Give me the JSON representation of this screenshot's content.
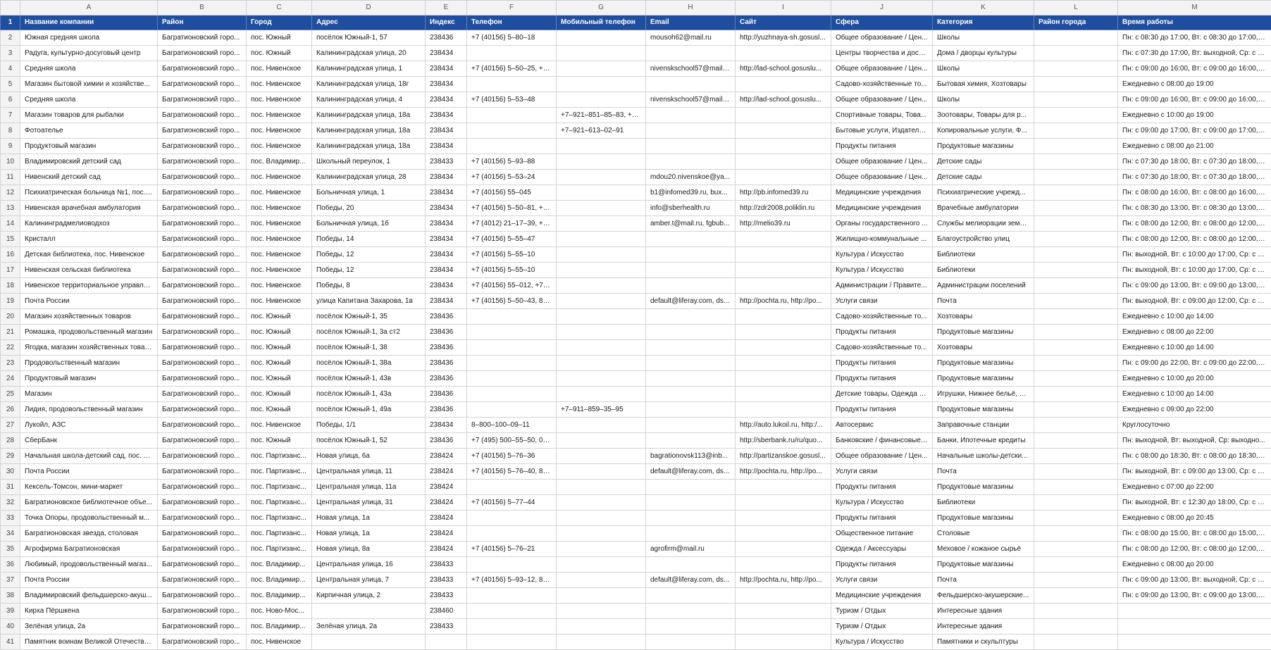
{
  "colors": {
    "header_bg": "#1f4e9e",
    "header_text": "#ffffff",
    "grid": "#d4d4d4"
  },
  "column_letters": [
    "A",
    "B",
    "C",
    "D",
    "E",
    "F",
    "G",
    "H",
    "I",
    "J",
    "K",
    "L",
    "M"
  ],
  "headers": [
    "Название компании",
    "Район",
    "Город",
    "Адрес",
    "Индекс",
    "Телефон",
    "Мобильный телефон",
    "Email",
    "Сайт",
    "Сфера",
    "Категория",
    "Район города",
    "Время работы"
  ],
  "rows": [
    {
      "n": "2",
      "c": [
        "Южная средняя школа",
        "Багратионовский горо...",
        "пос. Южный",
        "посёлок Южный-1, 57",
        "238436",
        "+7 (40156) 5‒80‒18",
        "",
        "mousoh62@mail.ru",
        "http://yuzhnaya-sh.gosusl...",
        "Общее образование / Цен...",
        "Школы",
        "",
        "Пн: с 08:30 до 17:00, Вт: с 08:30 до 17:00, Ср..."
      ]
    },
    {
      "n": "3",
      "c": [
        "Радуга, культурно-досуговый центр",
        "Багратионовский горо...",
        "пос. Южный",
        "Калининградская улица, 20",
        "238434",
        "",
        "",
        "",
        "",
        "Центры творчества и досуга",
        "Дома / дворцы культуры",
        "",
        "Пн: с 07:30 до 17:00, Вт: выходной, Ср: с 0..."
      ]
    },
    {
      "n": "4",
      "c": [
        "Средняя школа",
        "Багратионовский горо...",
        "пос. Нивенское",
        "Калининградская улица, 1",
        "238434",
        "+7 (40156) 5‒50‒25, +7...",
        "",
        "nivenskschool57@mail.r...",
        "http://lad-school.gosuslu...",
        "Общее образование / Цен...",
        "Школы",
        "",
        "Пн: с 09:00 до 16:00, Вт: с 09:00 до 16:00, С..."
      ]
    },
    {
      "n": "5",
      "c": [
        "Магазин бытовой химии и хозяйстве...",
        "Багратионовский горо...",
        "пос. Нивенское",
        "Калининградская улица, 18г",
        "238434",
        "",
        "",
        "",
        "",
        "Садово-хозяйственные то...",
        "Бытовая химия, Хозтовары",
        "",
        "Ежедневно с 08:00 до 19:00"
      ]
    },
    {
      "n": "6",
      "c": [
        "Средняя школа",
        "Багратионовский горо...",
        "пос. Нивенское",
        "Калининградская улица, 4",
        "238434",
        "+7 (40156) 5‒53‒48",
        "",
        "nivenskschool57@mail.r...",
        "http://lad-school.gosuslu...",
        "Общее образование / Цен...",
        "Школы",
        "",
        "Пн: с 09:00 до 16:00, Вт: с 09:00 до 16:00, С..."
      ]
    },
    {
      "n": "7",
      "c": [
        "Магазин товаров для рыбалки",
        "Багратионовский горо...",
        "пос. Нивенское",
        "Калининградская улица, 18а",
        "238434",
        "",
        "+7‒921‒851‒85‒83, +7...",
        "",
        "",
        "Спортивные товары, Това...",
        "Зоотовары, Товары для р...",
        "",
        "Ежедневно с 10:00 до 19:00"
      ]
    },
    {
      "n": "8",
      "c": [
        "Фотоателье",
        "Багратионовский горо...",
        "пос. Нивенское",
        "Калининградская улица, 18а",
        "238434",
        "",
        "+7‒921‒613‒02‒91",
        "",
        "",
        "Бытовые услуги, Издатель...",
        "Копировальные услуги, Ф...",
        "",
        "Пн: с 09:00 до 17:00, Вт: с 09:00 до 17:00, С..."
      ]
    },
    {
      "n": "9",
      "c": [
        "Продуктовый магазин",
        "Багратионовский горо...",
        "пос. Нивенское",
        "Калининградская улица, 18а",
        "238434",
        "",
        "",
        "",
        "",
        "Продукты питания",
        "Продуктовые магазины",
        "",
        "Ежедневно с 08:00 до 21:00"
      ]
    },
    {
      "n": "10",
      "c": [
        "Владимировский детский сад",
        "Багратионовский горо...",
        "пос. Владимир...",
        "Школьный переулок, 1",
        "238433",
        "+7 (40156) 5‒93‒88",
        "",
        "",
        "",
        "Общее образование / Цен...",
        "Детские сады",
        "",
        "Пн: с 07:30 до 18:00, Вт: с 07:30 до 18:00, С..."
      ]
    },
    {
      "n": "11",
      "c": [
        "Нивенский детский сад",
        "Багратионовский горо...",
        "пос. Нивенское",
        "Калининградская улица, 28",
        "238434",
        "+7 (40156) 5‒53‒24",
        "",
        "mdou20.nivenskoe@ya...",
        "",
        "Общее образование / Цен...",
        "Детские сады",
        "",
        "Пн: с 07:30 до 18:00, Вт: с 07:30 до 18:00, С..."
      ]
    },
    {
      "n": "12",
      "c": [
        "Психиатрическая больница №1, пос. ...",
        "Багратионовский горо...",
        "пос. Нивенское",
        "Больничная улица, 1",
        "238434",
        "+7 (40156) 55‒045",
        "",
        "b1@infomed39.ru, bux...",
        "http://pb.infomed39.ru",
        "Медицинские учреждения",
        "Психиатрические учрежд...",
        "",
        "Пн: с 08:00 до 16:00, Вт: с 08:00 до 16:00, С..."
      ]
    },
    {
      "n": "13",
      "c": [
        "Нивенская врачебная амбулатория",
        "Багратионовский горо...",
        "пос. Нивенское",
        "Победы, 20",
        "238434",
        "+7 (40156) 5‒50‒81, +7...",
        "",
        "info@sberhealth.ru",
        "http://zdr2008.poliklin.ru",
        "Медицинские учреждения",
        "Врачебные амбулатории",
        "",
        "Пн: с 08:30 до 13:00, Вт: с 08:30 до 13:00, С..."
      ]
    },
    {
      "n": "14",
      "c": [
        "Калининградмелиоводхоз",
        "Багратионовский горо...",
        "пос. Нивенское",
        "Больничная улица, 1б",
        "238434",
        "+7 (4012) 21‒17‒39, +7...",
        "",
        "amber.t@mail.ru, fgbub...",
        "http://melio39.ru",
        "Органы государственного ...",
        "Службы мелиорации земе...",
        "",
        "Пн: с 08:00 до 12:00, Вт: с 08:00 до 12:00, С..."
      ]
    },
    {
      "n": "15",
      "c": [
        "Кристалл",
        "Багратионовский горо...",
        "пос. Нивенское",
        "Победы, 14",
        "238434",
        "+7 (40156) 5‒55‒47",
        "",
        "",
        "",
        "Жилищно-коммунальные ...",
        "Благоустройство улиц",
        "",
        "Пн: с 08:00 до 12:00, Вт: с 08:00 до 12:00, С..."
      ]
    },
    {
      "n": "16",
      "c": [
        "Детская библиотека, пос. Нивенское",
        "Багратионовский горо...",
        "пос. Нивенское",
        "Победы, 12",
        "238434",
        "+7 (40156) 5‒55‒10",
        "",
        "",
        "",
        "Культура / Искусство",
        "Библиотеки",
        "",
        "Пн: выходной, Вт: с 10:00 до 17:00, Ср: с 1..."
      ]
    },
    {
      "n": "17",
      "c": [
        "Нивенская сельская библиотека",
        "Багратионовский горо...",
        "пос. Нивенское",
        "Победы, 12",
        "238434",
        "+7 (40156) 5‒55‒10",
        "",
        "",
        "",
        "Культура / Искусство",
        "Библиотеки",
        "",
        "Пн: выходной, Вт: с 10:00 до 17:00, Ср: с 1..."
      ]
    },
    {
      "n": "18",
      "c": [
        "Нивенское территориальное управле...",
        "Багратионовский горо...",
        "пос. Нивенское",
        "Победы, 8",
        "238434",
        "+7 (40156) 55‒012, +7 (...",
        "",
        "",
        "",
        "Администрации / Правите...",
        "Администрации поселений",
        "",
        "Пн: с 09:00 до 13:00, Вт: с 09:00 до 13:00, С..."
      ]
    },
    {
      "n": "19",
      "c": [
        "Почта России",
        "Багратионовский горо...",
        "пос. Нивенское",
        "улица Капитана Захарова, 1в",
        "238434",
        "+7 (40156) 5‒50‒43, 8‒...",
        "",
        "default@liferay.com, ds...",
        "http://pochta.ru, http://po...",
        "Услуги связи",
        "Почта",
        "",
        "Пн: выходной, Вт: с 09:00 до 12:00, Ср: с 0..."
      ]
    },
    {
      "n": "20",
      "c": [
        "Магазин хозяйственных товаров",
        "Багратионовский горо...",
        "пос. Южный",
        "посёлок Южный-1, 35",
        "238436",
        "",
        "",
        "",
        "",
        "Садово-хозяйственные то...",
        "Хозтовары",
        "",
        "Ежедневно с 10:00 до 14:00"
      ]
    },
    {
      "n": "21",
      "c": [
        "Ромашка, продовольственный магазин",
        "Багратионовский горо...",
        "пос. Южный",
        "посёлок Южный-1, 3а ст2",
        "238436",
        "",
        "",
        "",
        "",
        "Продукты питания",
        "Продуктовые магазины",
        "",
        "Ежедневно с 08:00 до 22:00"
      ]
    },
    {
      "n": "22",
      "c": [
        "Ягодка, магазин хозяйственных товар...",
        "Багратионовский горо...",
        "пос. Южный",
        "посёлок Южный-1, 38",
        "238436",
        "",
        "",
        "",
        "",
        "Садово-хозяйственные то...",
        "Хозтовары",
        "",
        "Ежедневно с 10:00 до 14:00"
      ]
    },
    {
      "n": "23",
      "c": [
        "Продовольственный магазин",
        "Багратионовский горо...",
        "пос. Южный",
        "посёлок Южный-1, 38а",
        "238436",
        "",
        "",
        "",
        "",
        "Продукты питания",
        "Продуктовые магазины",
        "",
        "Пн: с 09:00 до 22:00, Вт: с 09:00 до 22:00, С..."
      ]
    },
    {
      "n": "24",
      "c": [
        "Продуктовый магазин",
        "Багратионовский горо...",
        "пос. Южный",
        "посёлок Южный-1, 43в",
        "238436",
        "",
        "",
        "",
        "",
        "Продукты питания",
        "Продуктовые магазины",
        "",
        "Ежедневно с 10:00 до 20:00"
      ]
    },
    {
      "n": "25",
      "c": [
        "Магазин",
        "Багратионовский горо...",
        "пос. Южный",
        "посёлок Южный-1, 43а",
        "238436",
        "",
        "",
        "",
        "",
        "Детские товары, Одежда / ...",
        "Игрушки, Нижнее бельё, Х...",
        "",
        "Ежедневно с 10:00 до 14:00"
      ]
    },
    {
      "n": "26",
      "c": [
        "Лидия, продовольственный магазин",
        "Багратионовский горо...",
        "пос. Южный",
        "посёлок Южный-1, 49а",
        "238436",
        "",
        "+7‒911‒859‒35‒95",
        "",
        "",
        "Продукты питания",
        "Продуктовые магазины",
        "",
        "Ежедневно с 09:00 до 22:00"
      ]
    },
    {
      "n": "27",
      "c": [
        "Лукойл, АЗС",
        "Багратионовский горо...",
        "пос. Нивенское",
        "Победы, 1/1",
        "238434",
        "8‒800‒100‒09‒11",
        "",
        "",
        "http://auto.lukoil.ru, http:/...",
        "Автосервис",
        "Заправочные станции",
        "",
        "Круглосуточно"
      ]
    },
    {
      "n": "28",
      "c": [
        "СберБанк",
        "Багратионовский горо...",
        "пос. Южный",
        "посёлок Южный-1, 52",
        "238436",
        "+7 (495) 500‒55‒50, 03...",
        "",
        "",
        "http://sberbank.ru/ru/quo...",
        "Банковские / финансовые ...",
        "Банки, Ипотечные кредиты",
        "",
        "Пн: выходной, Вт: выходной, Ср: выходно..."
      ]
    },
    {
      "n": "29",
      "c": [
        "Начальная школа-детский сад, пос. П...",
        "Багратионовский горо...",
        "пос. Партизанс...",
        "Новая улица, 6а",
        "238424",
        "+7 (40156) 5‒76‒36",
        "",
        "bagrationovsk113@inb...",
        "http://partizanskoe.gosusl...",
        "Общее образование / Цен...",
        "Начальные школы-детски...",
        "",
        "Пн: с 08:00 до 18:30, Вт: с 08:00 до 18:30, С..."
      ]
    },
    {
      "n": "30",
      "c": [
        "Почта России",
        "Багратионовский горо...",
        "пос. Партизанс...",
        "Центральная улица, 11",
        "238424",
        "+7 (40156) 5‒76‒40, 8‒...",
        "",
        "default@liferay.com, ds...",
        "http://pochta.ru, http://po...",
        "Услуги связи",
        "Почта",
        "",
        "Пн: выходной, Вт: с 09:00 до 13:00, Ср: с 0..."
      ]
    },
    {
      "n": "31",
      "c": [
        "Кексель-Томсон, мини-маркет",
        "Багратионовский горо...",
        "пос. Партизанс...",
        "Центральная улица, 11а",
        "238424",
        "",
        "",
        "",
        "",
        "Продукты питания",
        "Продуктовые магазины",
        "",
        "Ежедневно с 07:00 до 22:00"
      ]
    },
    {
      "n": "32",
      "c": [
        "Багратионовское библиотечное объе...",
        "Багратионовский горо...",
        "пос. Партизанс...",
        "Центральная улица, 31",
        "238424",
        "+7 (40156) 5‒77‒44",
        "",
        "",
        "",
        "Культура / Искусство",
        "Библиотеки",
        "",
        "Пн: выходной, Вт: с 12:30 до 18:00, Ср: с 1..."
      ]
    },
    {
      "n": "33",
      "c": [
        "Точка Опоры, продовольственный м...",
        "Багратионовский горо...",
        "пос. Партизанс...",
        "Новая улица, 1а",
        "238424",
        "",
        "",
        "",
        "",
        "Продукты питания",
        "Продуктовые магазины",
        "",
        "Ежедневно с 08:00 до 20:45"
      ]
    },
    {
      "n": "34",
      "c": [
        "Багратионовская звезда, столовая",
        "Багратионовский горо...",
        "пос. Партизанс...",
        "Новая улица, 1а",
        "238424",
        "",
        "",
        "",
        "",
        "Общественное питание",
        "Столовые",
        "",
        "Пн: с 08:00 до 15:00, Вт: с 08:00 до 15:00, С..."
      ]
    },
    {
      "n": "35",
      "c": [
        "Агрофирма Багратионовская",
        "Багратионовский горо...",
        "пос. Партизанс...",
        "Новая улица, 8а",
        "238424",
        "+7 (40156) 5‒76‒21",
        "",
        "agrofirm@mail.ru",
        "",
        "Одежда / Аксессуары",
        "Меховое / кожаное сырьё",
        "",
        "Пн: с 08:00 до 12:00, Вт: с 08:00 до 12:00, С..."
      ]
    },
    {
      "n": "36",
      "c": [
        "Любимый, продовольственный магаз...",
        "Багратионовский горо...",
        "пос. Владимир...",
        "Центральная улица, 16",
        "238433",
        "",
        "",
        "",
        "",
        "Продукты питания",
        "Продуктовые магазины",
        "",
        "Ежедневно с 08:00 до 20:00"
      ]
    },
    {
      "n": "37",
      "c": [
        "Почта России",
        "Багратионовский горо...",
        "пос. Владимир...",
        "Центральная улица, 7",
        "238433",
        "+7 (40156) 5‒93‒12, 8‒...",
        "",
        "default@liferay.com, ds...",
        "http://pochta.ru, http://po...",
        "Услуги связи",
        "Почта",
        "",
        "Пн: с 09:00 до 13:00, Вт: выходной, Ср: с 0..."
      ]
    },
    {
      "n": "38",
      "c": [
        "Владимировский фельдшерско-акуш...",
        "Багратионовский горо...",
        "пос. Владимир...",
        "Кирпичная улица, 2",
        "238433",
        "",
        "",
        "",
        "",
        "Медицинские учреждения",
        "Фельдшерско-акушерские...",
        "",
        "Пн: с 09:00 до 13:00, Вт: с 09:00 до 13:00, С..."
      ]
    },
    {
      "n": "39",
      "c": [
        "Кирха Пёршкена",
        "Багратионовский горо...",
        "пос. Ново-Мос...",
        "",
        "238460",
        "",
        "",
        "",
        "",
        "Туризм / Отдых",
        "Интересные здания",
        "",
        ""
      ]
    },
    {
      "n": "40",
      "c": [
        "Зелёная улица, 2а",
        "Багратионовский горо...",
        "пос. Владимир...",
        "Зелёная улица, 2а",
        "238433",
        "",
        "",
        "",
        "",
        "Туризм / Отдых",
        "Интересные здания",
        "",
        ""
      ]
    },
    {
      "n": "41",
      "c": [
        "Памятник воинам Великой Отечестве...",
        "Багратионовский горо...",
        "пос. Нивенское",
        "",
        "",
        "",
        "",
        "",
        "",
        "Культура / Искусство",
        "Памятники и скульптуры",
        "",
        ""
      ]
    }
  ]
}
